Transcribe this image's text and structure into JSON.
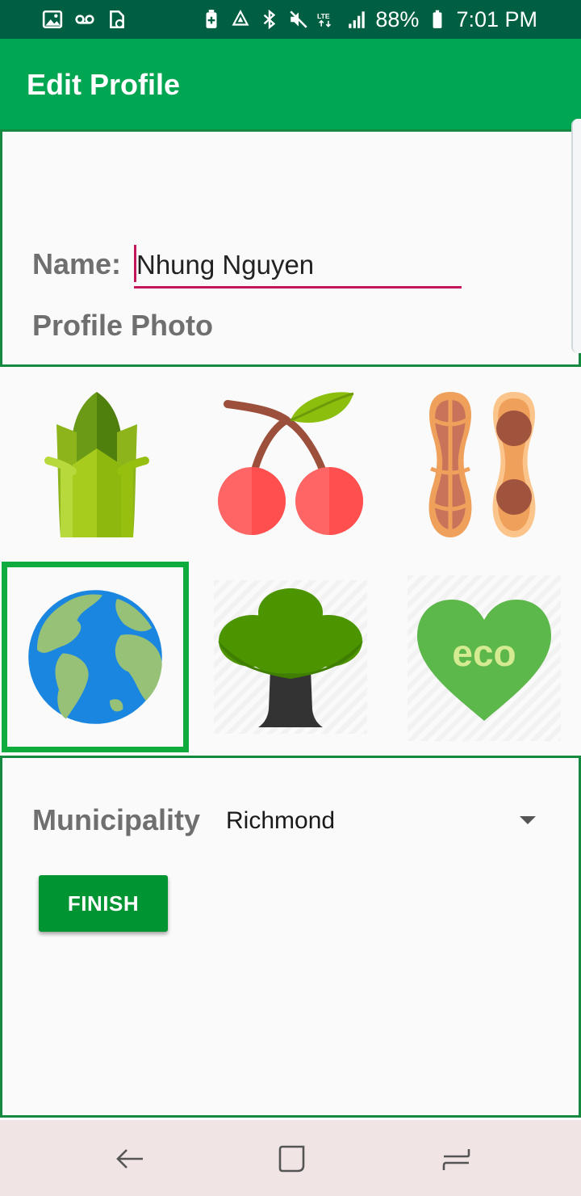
{
  "status_bar": {
    "left_icons": [
      "image-icon",
      "voicemail-icon",
      "storage-icon"
    ],
    "right_icons": [
      "battery-saver-icon",
      "recycle-icon",
      "bluetooth-icon",
      "mute-icon",
      "lte-icon",
      "signal-icon"
    ],
    "battery": "88%",
    "time": "7:01 PM"
  },
  "app_bar": {
    "title": "Edit Profile"
  },
  "profile": {
    "name_label": "Name:",
    "name_value": "Nhung Nguyen",
    "photo_label": "Profile Photo"
  },
  "photos": [
    {
      "name": "corn-icon",
      "selected": false
    },
    {
      "name": "cherry-icon",
      "selected": false
    },
    {
      "name": "peanut-icon",
      "selected": false
    },
    {
      "name": "earth-icon",
      "selected": true
    },
    {
      "name": "tree-icon",
      "selected": false
    },
    {
      "name": "eco-heart-icon",
      "selected": false,
      "text": "eco"
    }
  ],
  "municipality": {
    "label": "Municipality",
    "value": "Richmond"
  },
  "actions": {
    "finish_label": "FINISH"
  },
  "colors": {
    "status_bar": "#005f43",
    "app_bar": "#00a651",
    "border": "#14893f",
    "button": "#009432",
    "accent": "#c2185b"
  }
}
